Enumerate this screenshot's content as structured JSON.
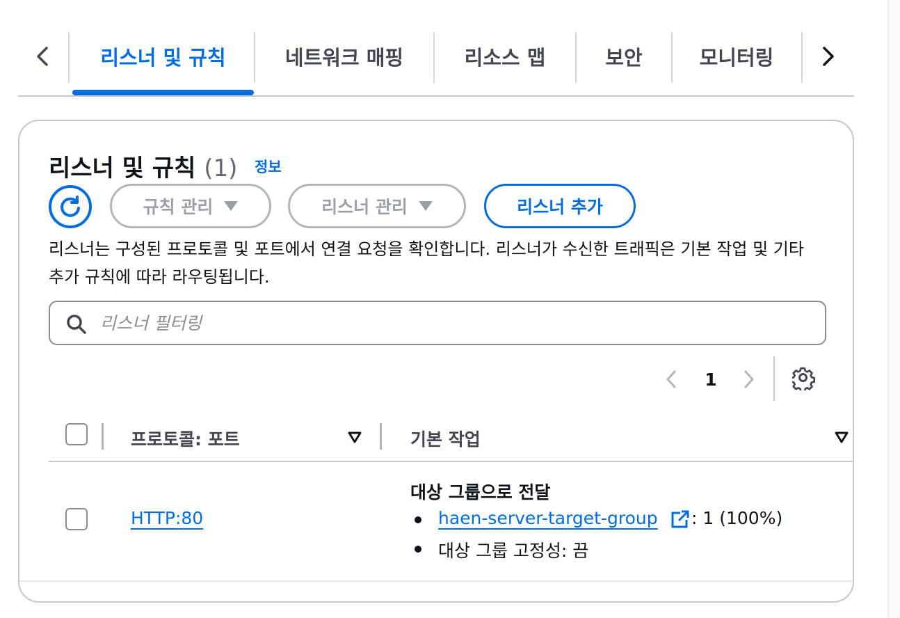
{
  "tabs": {
    "items": [
      {
        "label": "리스너 및 규칙",
        "active": true
      },
      {
        "label": "네트워크 매핑",
        "active": false
      },
      {
        "label": "리소스 맵",
        "active": false
      },
      {
        "label": "보안",
        "active": false
      },
      {
        "label": "모니터링",
        "active": false
      }
    ],
    "prev_icon": "chevron-left-icon",
    "next_icon": "chevron-right-icon"
  },
  "panel": {
    "title": "리스너 및 규칙",
    "count": "(1)",
    "info_link": "정보",
    "buttons": {
      "refresh_icon": "refresh-icon",
      "manage_rules": "규칙 관리",
      "manage_listeners": "리스너 관리",
      "add_listener": "리스너 추가"
    },
    "description": "리스너는 구성된 프로토콜 및 포트에서 연결 요청을 확인합니다. 리스너가 수신한 트래픽은 기본 작업 및 기타 추가 규칙에 따라 라우팅됩니다.",
    "search": {
      "placeholder": "리스너 필터링",
      "value": ""
    },
    "pagination": {
      "page": "1"
    },
    "table": {
      "columns": [
        "프로토콜: 포트",
        "기본 작업"
      ],
      "rows": [
        {
          "protocol_port": "HTTP:80",
          "action_title": "대상 그룹으로 전달",
          "target_group": "haen-server-target-group",
          "weight": ": 1 (100%)",
          "stickiness": "대상 그룹 고정성: 끔"
        }
      ]
    }
  },
  "colors": {
    "accent": "#006ce0",
    "text": "#0f141a",
    "muted": "#656871",
    "border": "#c6c6cd"
  }
}
